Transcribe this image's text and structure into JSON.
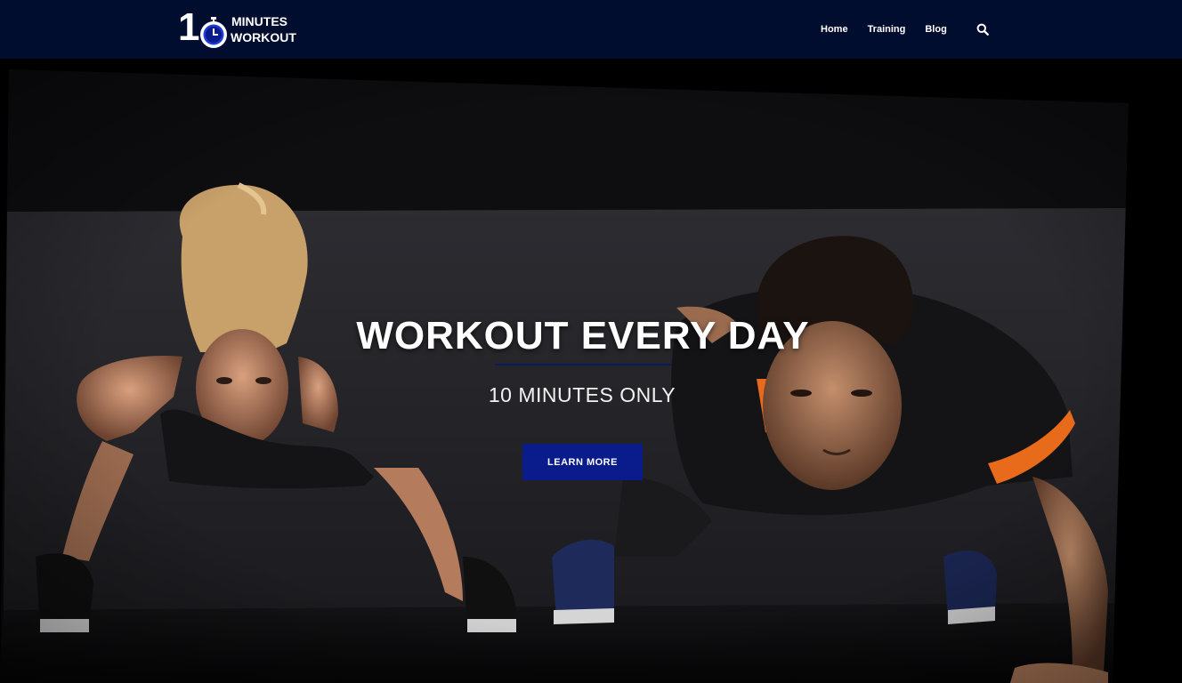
{
  "brand": {
    "logo_number": "10",
    "logo_line1": "MINUTES",
    "logo_line2": "WORKOUT"
  },
  "nav": {
    "items": [
      {
        "label": "Home"
      },
      {
        "label": "Training"
      },
      {
        "label": "Blog"
      }
    ],
    "search_icon": "search-icon"
  },
  "hero": {
    "title": "WORKOUT EVERY DAY",
    "subtitle": "10 MINUTES ONLY",
    "button_label": "LEARN MORE"
  },
  "colors": {
    "header_bg": "#010d2e",
    "accent": "#0a1b8c",
    "clock_blue": "#1e3bd6"
  }
}
